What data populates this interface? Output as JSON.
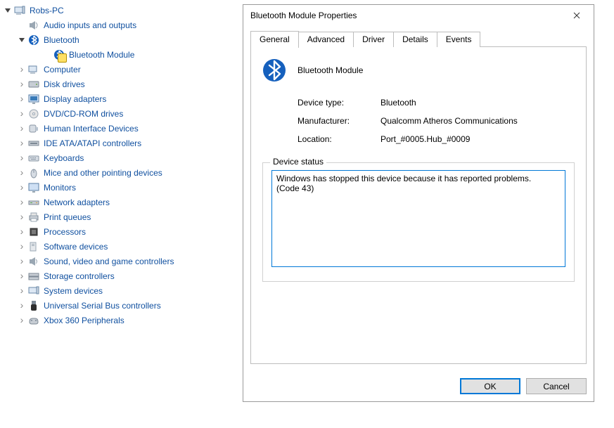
{
  "tree": {
    "root": {
      "label": "Robs-PC",
      "expanded": true
    },
    "nodes": [
      {
        "label": "Audio inputs and outputs",
        "icon": "speaker",
        "expanded": false,
        "expandable": false
      },
      {
        "label": "Bluetooth",
        "icon": "bluetooth",
        "expanded": true,
        "expandable": true,
        "children": [
          {
            "label": "Bluetooth Module",
            "icon": "bluetooth",
            "warn": true
          }
        ]
      },
      {
        "label": "Computer",
        "icon": "computer",
        "expandable": true
      },
      {
        "label": "Disk drives",
        "icon": "disk",
        "expandable": true
      },
      {
        "label": "Display adapters",
        "icon": "display",
        "expandable": true
      },
      {
        "label": "DVD/CD-ROM drives",
        "icon": "dvd",
        "expandable": true
      },
      {
        "label": "Human Interface Devices",
        "icon": "hid",
        "expandable": true
      },
      {
        "label": "IDE ATA/ATAPI controllers",
        "icon": "ide",
        "expandable": true
      },
      {
        "label": "Keyboards",
        "icon": "keyboard",
        "expandable": true
      },
      {
        "label": "Mice and other pointing devices",
        "icon": "mouse",
        "expandable": true
      },
      {
        "label": "Monitors",
        "icon": "monitor",
        "expandable": true
      },
      {
        "label": "Network adapters",
        "icon": "network",
        "expandable": true
      },
      {
        "label": "Print queues",
        "icon": "printer",
        "expandable": true
      },
      {
        "label": "Processors",
        "icon": "cpu",
        "expandable": true
      },
      {
        "label": "Software devices",
        "icon": "software",
        "expandable": true
      },
      {
        "label": "Sound, video and game controllers",
        "icon": "sound",
        "expandable": true
      },
      {
        "label": "Storage controllers",
        "icon": "storage",
        "expandable": true
      },
      {
        "label": "System devices",
        "icon": "system",
        "expandable": true
      },
      {
        "label": "Universal Serial Bus controllers",
        "icon": "usb",
        "expandable": true
      },
      {
        "label": "Xbox 360 Peripherals",
        "icon": "xbox",
        "expandable": true
      }
    ]
  },
  "dialog": {
    "title": "Bluetooth Module Properties",
    "tabs": [
      "General",
      "Advanced",
      "Driver",
      "Details",
      "Events"
    ],
    "active_tab": 0,
    "device_name": "Bluetooth Module",
    "info": {
      "device_type_label": "Device type:",
      "device_type_value": "Bluetooth",
      "manufacturer_label": "Manufacturer:",
      "manufacturer_value": "Qualcomm Atheros Communications",
      "location_label": "Location:",
      "location_value": "Port_#0005.Hub_#0009"
    },
    "status_label": "Device status",
    "status_text": "Windows has stopped this device because it has reported problems. (Code 43)",
    "ok_label": "OK",
    "cancel_label": "Cancel"
  }
}
